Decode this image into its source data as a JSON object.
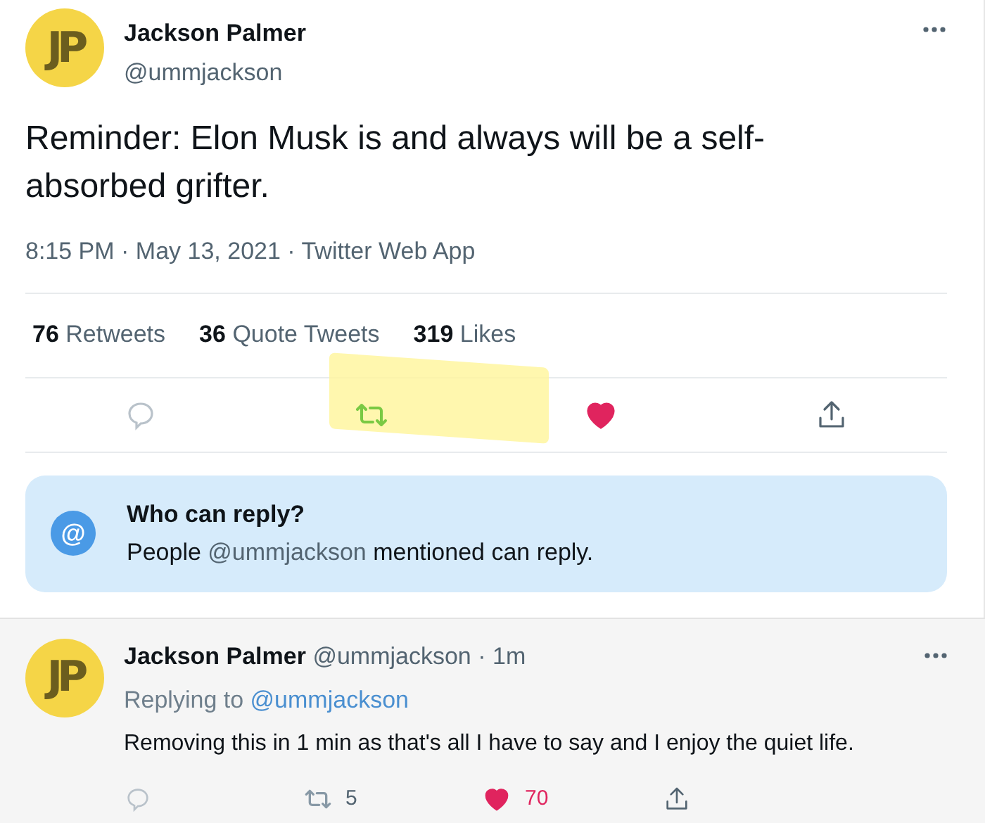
{
  "tweet": {
    "author": {
      "avatar_text": "JP",
      "name": "Jackson Palmer",
      "handle": "@ummjackson"
    },
    "text": "Reminder: Elon Musk is and always will be a self-absorbed grifter.",
    "meta": "8:15 PM · May 13, 2021 · Twitter Web App",
    "stats": [
      {
        "count": "76",
        "label": "Retweets"
      },
      {
        "count": "36",
        "label": "Quote Tweets"
      },
      {
        "count": "319",
        "label": "Likes"
      }
    ],
    "actions": [
      {
        "kind": "reply",
        "active": false,
        "highlighted": false
      },
      {
        "kind": "retweet",
        "active": true,
        "highlighted": true
      },
      {
        "kind": "like",
        "active": true,
        "highlighted": false
      },
      {
        "kind": "share",
        "active": false,
        "highlighted": false
      }
    ],
    "reply_notice": {
      "icon": "@",
      "title": "Who can reply?",
      "before": "People",
      "mention": "@ummjackson",
      "after": "mentioned can reply."
    }
  },
  "reply": {
    "author": {
      "avatar_text": "JP",
      "name": "Jackson Palmer",
      "handle": "@ummjackson",
      "separator": "·",
      "time": "1m"
    },
    "replying_label": "Replying to",
    "replying_to": "@ummjackson",
    "text": "Removing this in 1 min as that's all I have to say and I enjoy the quiet life.",
    "actions": [
      {
        "kind": "reply",
        "active": false
      },
      {
        "kind": "retweet",
        "active": false,
        "count": "5"
      },
      {
        "kind": "like",
        "active": true,
        "count": "70"
      },
      {
        "kind": "share",
        "active": false
      }
    ]
  }
}
